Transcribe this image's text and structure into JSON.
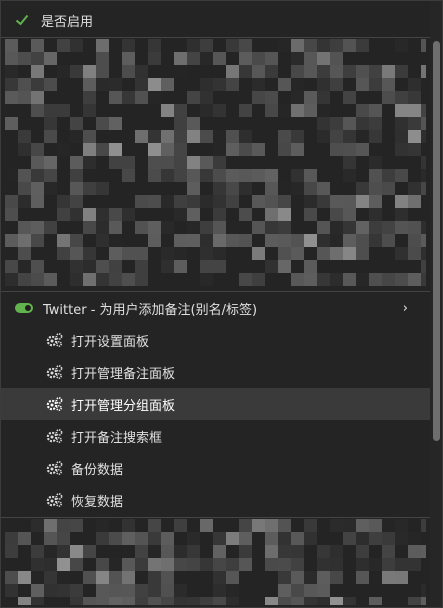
{
  "enable": {
    "label": "是否启用"
  },
  "script_item": {
    "label": "Twitter - 为用户添加备注(别名/标签)",
    "chevron": "›"
  },
  "submenu": [
    {
      "label": "打开设置面板",
      "icon": "gear-icon"
    },
    {
      "label": "打开管理备注面板",
      "icon": "gear-icon"
    },
    {
      "label": "打开管理分组面板",
      "icon": "gear-icon",
      "active": true
    },
    {
      "label": "打开备注搜索框",
      "icon": "gear-icon"
    },
    {
      "label": "备份数据",
      "icon": "gear-icon"
    },
    {
      "label": "恢复数据",
      "icon": "gear-icon"
    }
  ],
  "colors": {
    "toggle_on": "#62b34d",
    "check": "#62b34d",
    "menu_bg": "#242424",
    "active_bg": "#3a3a3a"
  }
}
